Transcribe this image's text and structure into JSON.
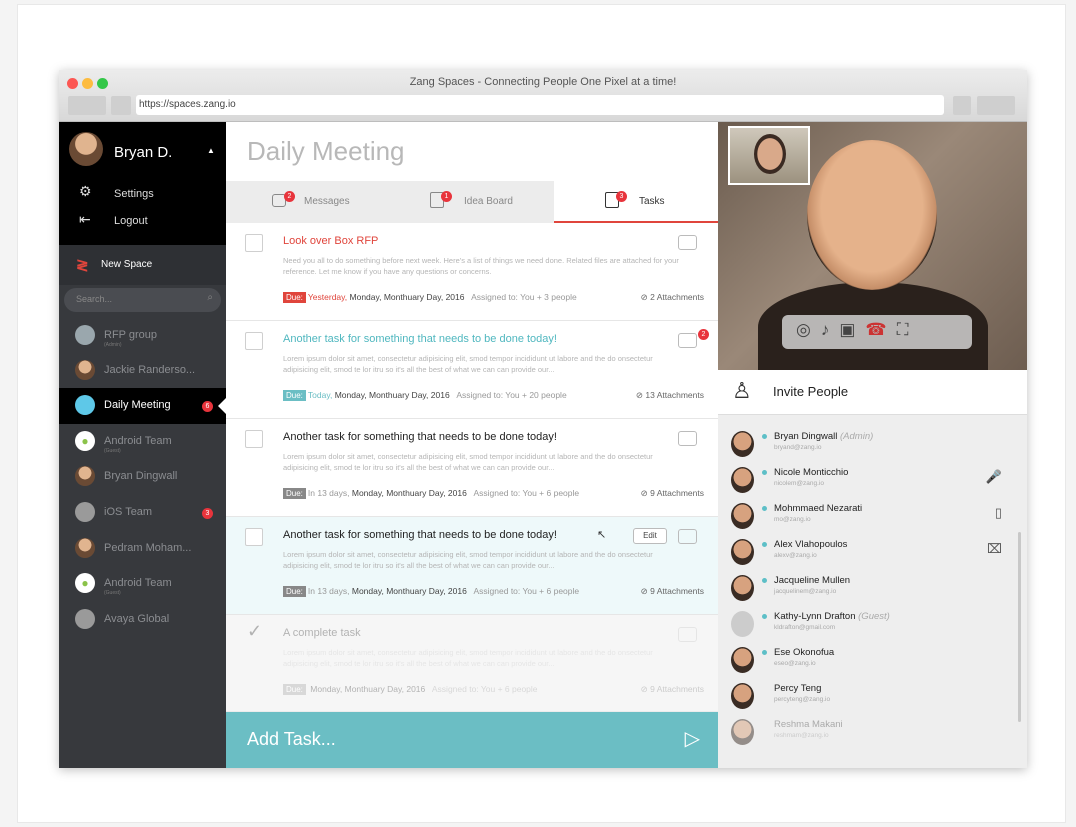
{
  "window": {
    "title": "Zang Spaces - Connecting People One Pixel at a time!",
    "url": "https://spaces.zang.io"
  },
  "user": {
    "name": "Bryan D.",
    "caret": "▲"
  },
  "menu": {
    "settings": "Settings",
    "logout": "Logout",
    "new_space": "New Space",
    "search_placeholder": "Search..."
  },
  "spaces": [
    {
      "label": "RFP group",
      "sub": "(Admin)",
      "icon": "group-avatar"
    },
    {
      "label": "Jackie Randerso...",
      "sub": "",
      "icon": "person-avatar"
    },
    {
      "label": "Daily Meeting",
      "sub": "",
      "icon": "space-icon",
      "badge": "6",
      "active": true
    },
    {
      "label": "Android Team",
      "sub": "(Guest)",
      "icon": "android-icon"
    },
    {
      "label": "Bryan Dingwall",
      "sub": "",
      "icon": "person-avatar"
    },
    {
      "label": "iOS Team",
      "sub": "",
      "icon": "apple-icon",
      "badge": "3"
    },
    {
      "label": "Pedram Moham...",
      "sub": "",
      "icon": "person-avatar"
    },
    {
      "label": "Android Team",
      "sub": "(Guest)",
      "icon": "android-icon"
    },
    {
      "label": "Avaya Global",
      "sub": "",
      "icon": "apple-icon"
    }
  ],
  "main": {
    "title": "Daily Meeting",
    "tabs": [
      {
        "label": "Messages",
        "badge": "2"
      },
      {
        "label": "Idea Board",
        "badge": "1"
      },
      {
        "label": "Tasks",
        "badge": "3"
      }
    ],
    "add_task": "Add Task..."
  },
  "tasks": [
    {
      "title": "Look over Box RFP",
      "desc": "Need you all to do something before next week. Here's a list of things we need done. Related files are attached for your reference. Let me know if you have any questions or concerns.",
      "due": "Due:",
      "when": "Yesterday,",
      "date": "Monday, Monthuary Day, 2016",
      "assigned": "Assigned to: You + 3 people",
      "attachments": "2 Attachments"
    },
    {
      "title": "Another task for something that needs to be done today!",
      "desc": "Lorem ipsum dolor sit amet, consectetur adipisicing elit, smod tempor incididunt ut labore and the do onsectetur adipisicing elit, smod te lor itru so it's all the best of what we can can provide our...",
      "due": "Due:",
      "when": "Today,",
      "date": "Monday, Monthuary Day, 2016",
      "assigned": "Assigned to: You + 20 people",
      "attachments": "13 Attachments",
      "comments": "2"
    },
    {
      "title": "Another task for something that needs to be done today!",
      "desc": "Lorem ipsum dolor sit amet, consectetur adipisicing elit, smod tempor incididunt ut labore and the do onsectetur adipisicing elit, smod te lor itru so it's all the best of what we can can provide our...",
      "due": "Due:",
      "when": "In 13 days,",
      "date": "Monday, Monthuary Day, 2016",
      "assigned": "Assigned to: You + 6 people",
      "attachments": "9 Attachments"
    },
    {
      "title": "Another task for something that needs to be done today!",
      "desc": "Lorem ipsum dolor sit amet, consectetur adipisicing elit, smod tempor incididunt ut labore and the do onsectetur adipisicing elit, smod te lor itru so it's all the best of what we can can provide our...",
      "due": "Due:",
      "when": "In 13 days,",
      "date": "Monday, Monthuary Day, 2016",
      "assigned": "Assigned to: You + 6 people",
      "attachments": "9 Attachments",
      "edit": "Edit"
    },
    {
      "title": "A complete task",
      "desc": "Lorem ipsum dolor sit amet, consectetur adipisicing elit, smod tempor incididunt ut labore and the do onsectetur adipisicing elit, smod te lor itru so it's all the best of what we can can provide our...",
      "due": "Due:",
      "when": "",
      "date": "Monday, Monthuary Day, 2016",
      "assigned": "Assigned to: You + 6 people",
      "attachments": "9 Attachments"
    }
  ],
  "invite": {
    "label": "Invite People"
  },
  "people": [
    {
      "name": "Bryan Dingwall",
      "role": "(Admin)",
      "email": "bryand@zang.io",
      "icon": ""
    },
    {
      "name": "Nicole Monticchio",
      "role": "",
      "email": "nicolem@zang.io",
      "icon": "🎤"
    },
    {
      "name": "Mohmmaed Nezarati",
      "role": "",
      "email": "mo@zang.io",
      "icon": "▯"
    },
    {
      "name": "Alex Vlahopoulos",
      "role": "",
      "email": "alexv@zang.io",
      "icon": "⌧"
    },
    {
      "name": "Jacqueline Mullen",
      "role": "",
      "email": "jacquelinem@zang.io",
      "icon": ""
    },
    {
      "name": "Kathy-Lynn Drafton",
      "role": "(Guest)",
      "email": "kldrafton@gmail.com",
      "icon": ""
    },
    {
      "name": "Ese Okonofua",
      "role": "",
      "email": "eseo@zang.io",
      "icon": ""
    },
    {
      "name": "Percy Teng",
      "role": "",
      "email": "percyteng@zang.io",
      "icon": ""
    },
    {
      "name": "Reshma Makani",
      "role": "",
      "email": "reshmam@zang.io",
      "icon": ""
    }
  ],
  "colors": {
    "accent": "#e0453c",
    "teal": "#6bbec4",
    "sidebar": "#37393d"
  }
}
